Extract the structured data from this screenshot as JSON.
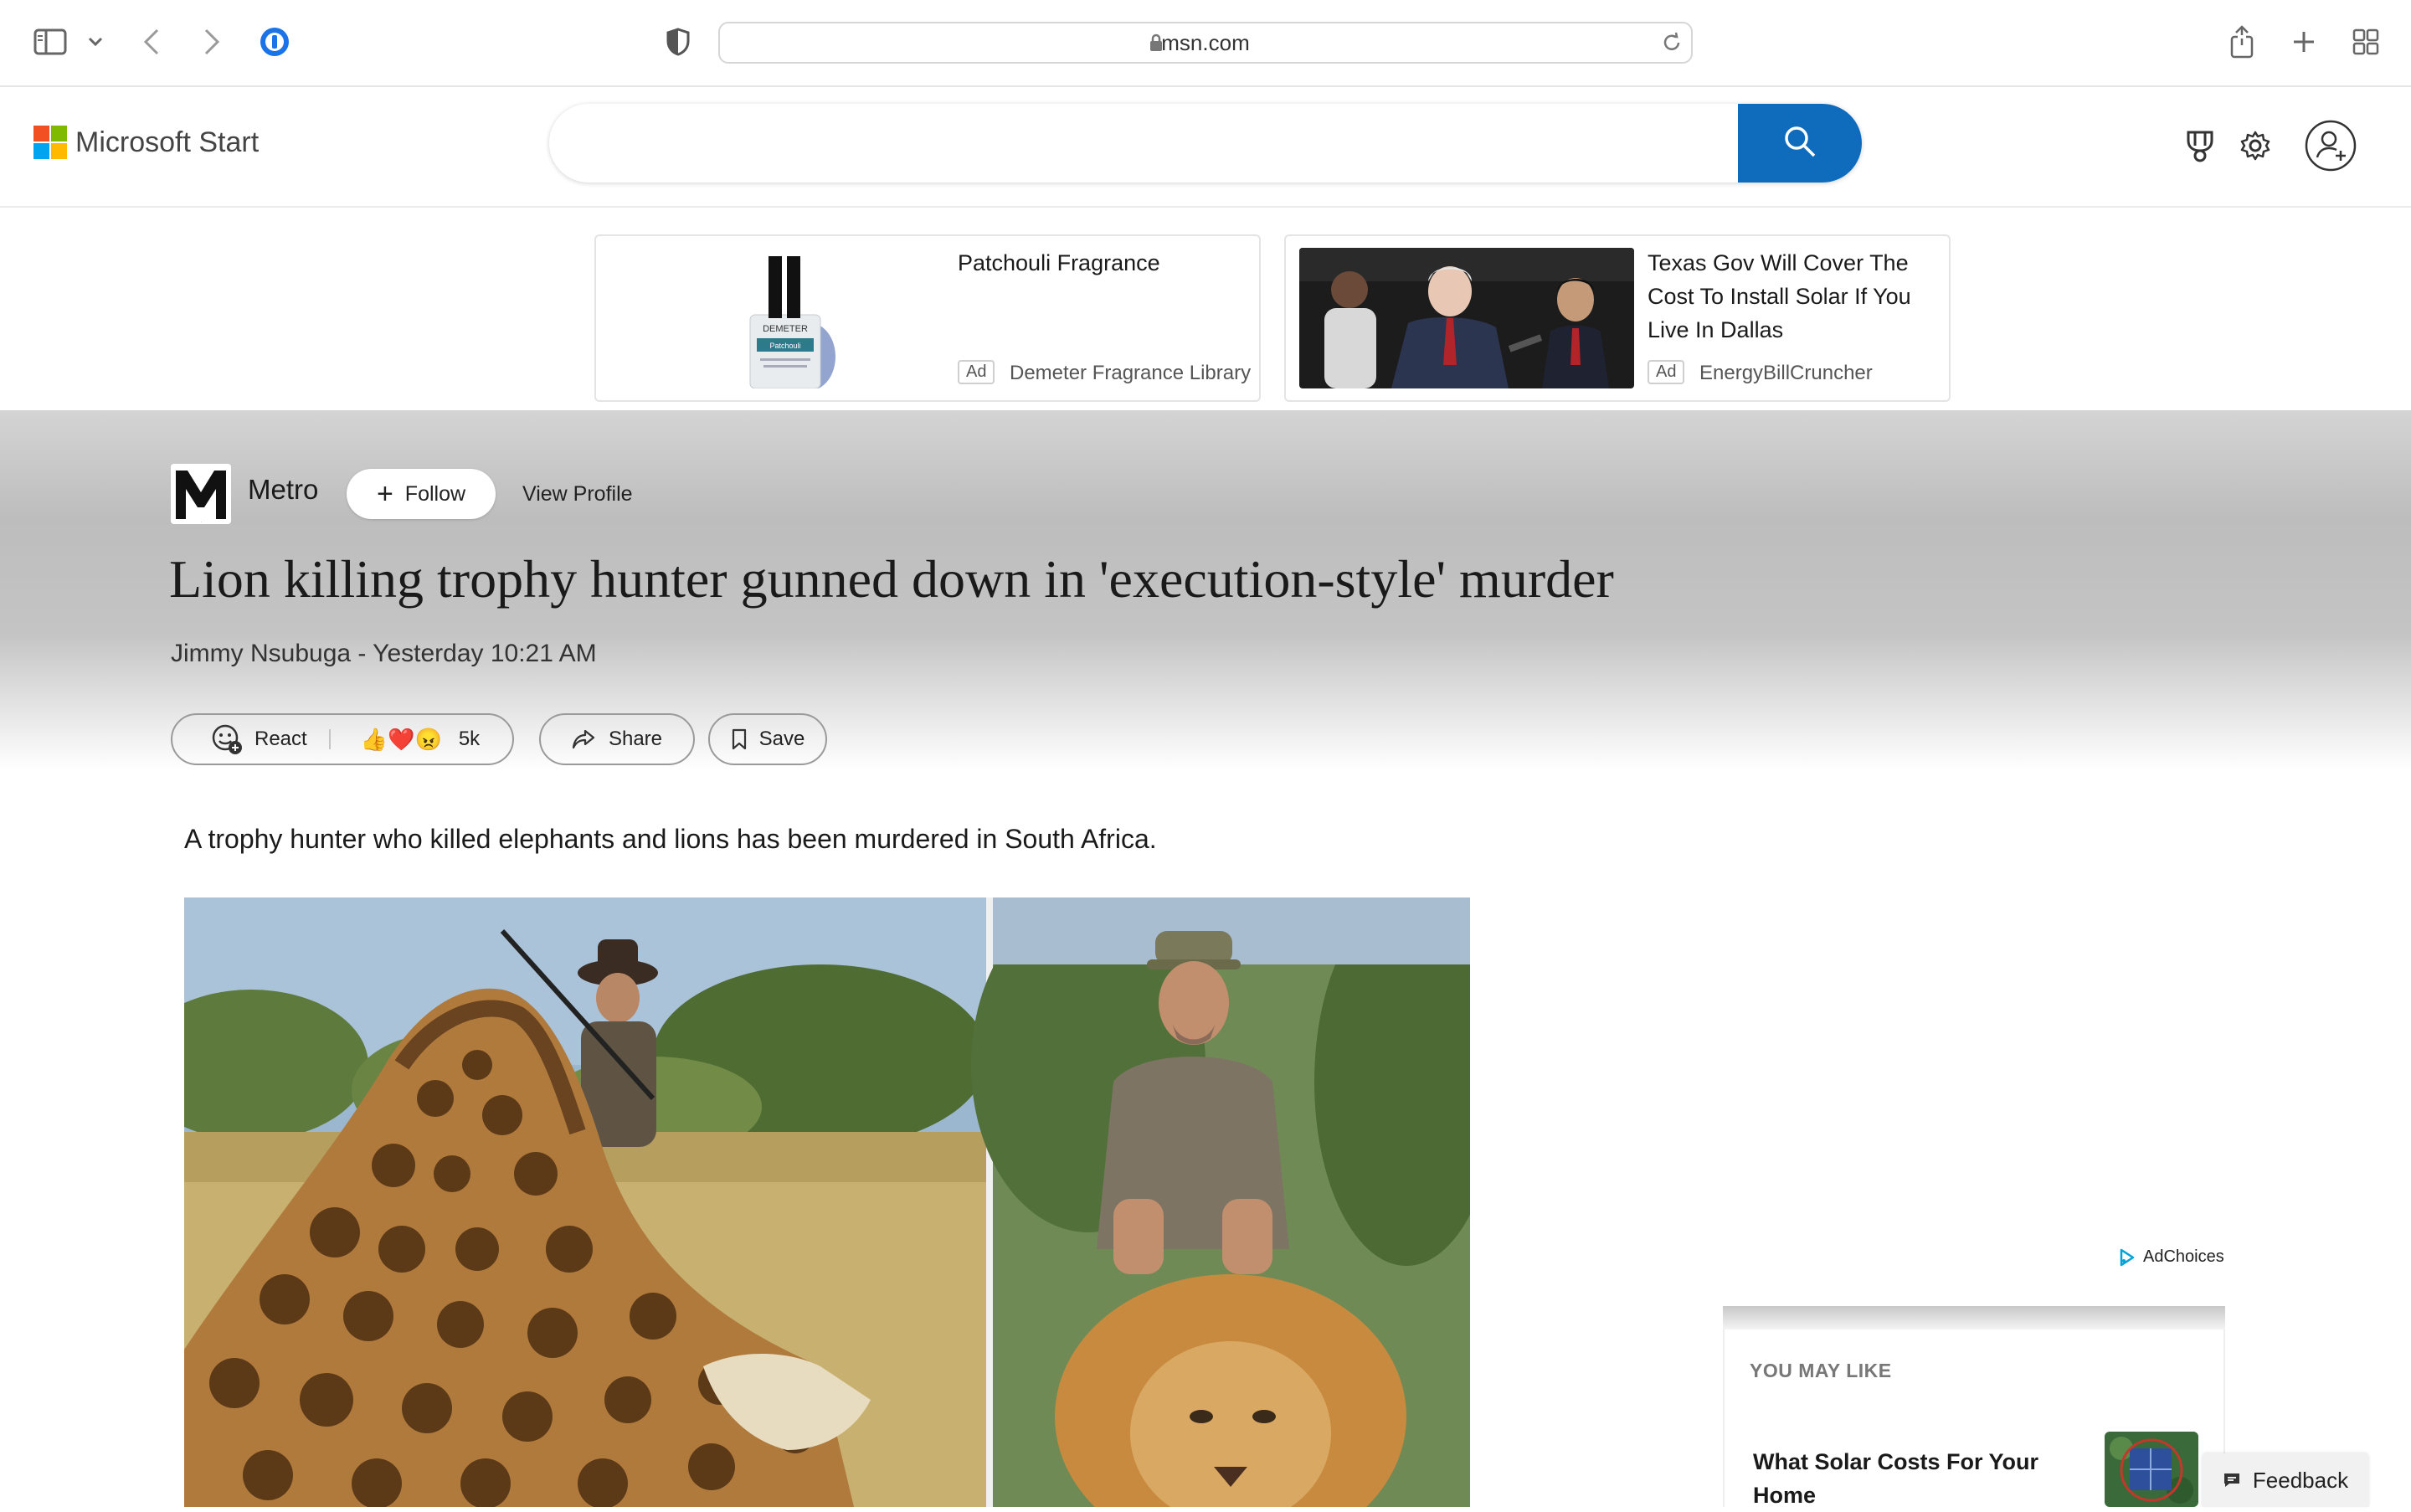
{
  "browser": {
    "url": "msn.com",
    "icons": [
      "sidebar-icon",
      "chevron-down-icon",
      "back-icon",
      "forward-icon",
      "password-manager-icon",
      "privacy-shield-icon",
      "lock-icon",
      "reload-icon",
      "share-icon",
      "new-tab-icon",
      "tab-overview-icon"
    ]
  },
  "header": {
    "brand": "Microsoft Start",
    "search": {
      "placeholder": "",
      "value": ""
    },
    "logo_colors": [
      "#f25022",
      "#7fba00",
      "#00a4ef",
      "#ffb900"
    ],
    "accent": "#0f6cbd",
    "icons": [
      "search-icon",
      "rewards-icon",
      "settings-icon",
      "profile-icon"
    ]
  },
  "ads": [
    {
      "title": "Patchouli Fragrance",
      "tag": "Ad",
      "source": "Demeter Fragrance Library",
      "bottle_label_top": "DEMETER",
      "bottle_label_mid": "Patchouli"
    },
    {
      "title": "Texas Gov Will Cover The Cost To Install Solar If You Live In Dallas",
      "tag": "Ad",
      "source": "EnergyBillCruncher"
    }
  ],
  "article": {
    "publisher": "Metro",
    "publisher_logo_letter": "M",
    "follow_label": "Follow",
    "view_profile_label": "View Profile",
    "headline": "Lion killing trophy hunter gunned down in 'execution-style' murder",
    "byline": "Jimmy Nsubuga - Yesterday 10:21 AM",
    "react_label": "React",
    "reaction_count": "5k",
    "reaction_emojis": "👍❤️😠",
    "share_label": "Share",
    "save_label": "Save",
    "lead": "A trophy hunter who killed elephants and lions has been murdered in South Africa."
  },
  "rail": {
    "adchoices": "AdChoices",
    "section_title": "YOU MAY LIKE",
    "item_title": "What Solar Costs For Your Home"
  },
  "feedback_label": "Feedback"
}
